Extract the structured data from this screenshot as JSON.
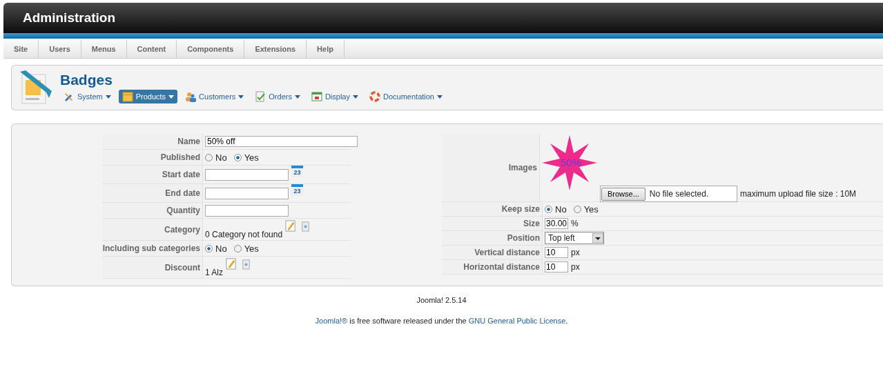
{
  "header": {
    "title": "Administration"
  },
  "menu": [
    {
      "label": "Site"
    },
    {
      "label": "Users"
    },
    {
      "label": "Menus"
    },
    {
      "label": "Content"
    },
    {
      "label": "Components"
    },
    {
      "label": "Extensions"
    },
    {
      "label": "Help"
    }
  ],
  "toolbar": {
    "title": "Badges",
    "items": [
      {
        "label": "System",
        "selected": false
      },
      {
        "label": "Products",
        "selected": true
      },
      {
        "label": "Customers",
        "selected": false
      },
      {
        "label": "Orders",
        "selected": false
      },
      {
        "label": "Display",
        "selected": false
      },
      {
        "label": "Documentation",
        "selected": false
      }
    ]
  },
  "left_fields": [
    {
      "kind": "long_text",
      "label": "Name",
      "value": "50% off"
    },
    {
      "kind": "radio",
      "label": "Published",
      "options": [
        {
          "label": "No",
          "selected": false
        },
        {
          "label": "Yes",
          "selected": true
        }
      ]
    },
    {
      "kind": "date",
      "label": "Start date",
      "calendar_day": "23"
    },
    {
      "kind": "date",
      "label": "End date",
      "calendar_day": "23"
    },
    {
      "kind": "text",
      "label": "Quantity"
    },
    {
      "kind": "picker",
      "label": "Category",
      "value": "0 Category not found"
    },
    {
      "kind": "radio",
      "label": "Including sub categories",
      "options": [
        {
          "label": "No",
          "selected": true
        },
        {
          "label": "Yes",
          "selected": false
        }
      ]
    },
    {
      "kind": "picker",
      "label": "Discount",
      "value": "1 Alz"
    }
  ],
  "images": {
    "label": "Images",
    "badge_text": "50%",
    "browse_button": "Browse...",
    "file_status": "No file selected.",
    "note": "maximum upload file size : 10M"
  },
  "right_fields": [
    {
      "kind": "radio",
      "label": "Keep size",
      "options": [
        {
          "label": "No",
          "selected": true
        },
        {
          "label": "Yes",
          "selected": false
        }
      ]
    },
    {
      "kind": "unit",
      "label": "Size",
      "value": "30.00",
      "unit": "%"
    },
    {
      "kind": "select",
      "label": "Position",
      "value": "Top left"
    },
    {
      "kind": "unit",
      "label": "Vertical distance",
      "value": "10",
      "unit": "px"
    },
    {
      "kind": "unit",
      "label": "Horizontal distance",
      "value": "10",
      "unit": "px"
    }
  ],
  "footer": {
    "version": "Joomla! 2.5.14",
    "license": [
      {
        "kind": "link",
        "text": "Joomla!®"
      },
      {
        "kind": "plain",
        "text": " is free software released under the "
      },
      {
        "kind": "link",
        "text": "GNU General Public License"
      },
      {
        "kind": "plain",
        "text": "."
      }
    ]
  }
}
